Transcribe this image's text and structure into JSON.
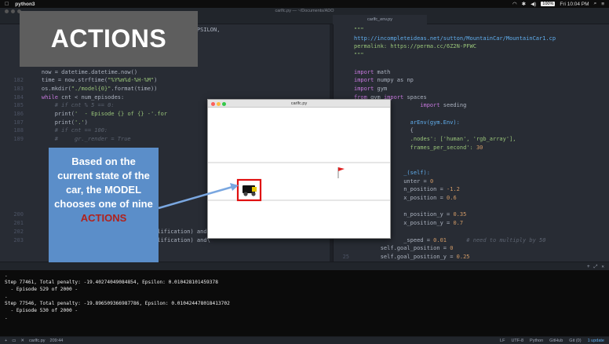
{
  "menubar": {
    "apple": "",
    "app_name": "python3",
    "battery": "100%",
    "clock": "Fri 10:04 PM"
  },
  "editor": {
    "window_title": "carlfc.py — ~/Documents/ADO",
    "left_tab": "",
    "right_tab": "carlfc_env.py",
    "left_lines": [
      {
        "n": "",
        "segs": [
          {
            "t": "                                     EPSILON, MIN_EPSILON,",
            "c": ""
          }
        ]
      },
      {
        "n": "",
        "segs": [
          {
            "t": "",
            "c": ""
          }
        ]
      },
      {
        "n": "",
        "segs": [
          {
            "t": "",
            "c": ""
          }
        ]
      },
      {
        "n": "",
        "segs": [
          {
            "t": "",
            "c": ""
          }
        ]
      },
      {
        "n": "",
        "segs": [
          {
            "t": "",
            "c": ""
          }
        ]
      },
      {
        "n": "",
        "segs": [
          {
            "t": "    now = datetime.datetime.now()",
            "c": ""
          }
        ]
      },
      {
        "n": "182",
        "segs": [
          {
            "t": "    time = now.strftime(",
            "c": ""
          },
          {
            "t": "\"%Y%m%d-%H-%M\"",
            "c": "str"
          },
          {
            "t": ")",
            "c": ""
          }
        ]
      },
      {
        "n": "183",
        "segs": [
          {
            "t": "    os.mkdir(",
            "c": ""
          },
          {
            "t": "\"./model{0}\"",
            "c": "str"
          },
          {
            "t": ".format(time))",
            "c": ""
          }
        ]
      },
      {
        "n": "184",
        "segs": [
          {
            "t": "    ",
            "c": ""
          },
          {
            "t": "while",
            "c": "kw"
          },
          {
            "t": " cnt < num_episodes:",
            "c": ""
          }
        ]
      },
      {
        "n": "185",
        "segs": [
          {
            "t": "        # if cnt % 5 == 0:",
            "c": "cm"
          }
        ]
      },
      {
        "n": "186",
        "segs": [
          {
            "t": "        print(",
            "c": ""
          },
          {
            "t": "'  - Episode {} of {} -'.for",
            "c": "str"
          }
        ]
      },
      {
        "n": "187",
        "segs": [
          {
            "t": "        print(",
            "c": ""
          },
          {
            "t": "'.'",
            "c": "str"
          },
          {
            "t": ")",
            "c": ""
          }
        ]
      },
      {
        "n": "188",
        "segs": [
          {
            "t": "        # if cnt == 100:",
            "c": "cm"
          }
        ]
      },
      {
        "n": "189",
        "segs": [
          {
            "t": "        #     gr._render = True",
            "c": "cm"
          }
        ]
      },
      {
        "n": "",
        "segs": [
          {
            "t": "",
            "c": ""
          }
        ]
      },
      {
        "n": "",
        "segs": [
          {
            "t": "",
            "c": ""
          }
        ]
      },
      {
        "n": "",
        "segs": [
          {
            "t": "                      ore[cnt])",
            "c": "cm"
          }
        ]
      },
      {
        "n": "",
        "segs": [
          {
            "t": "",
            "c": ""
          }
        ]
      },
      {
        "n": "",
        "segs": [
          {
            "t": "                      tore[cnt] > qu",
            "c": ""
          }
        ]
      },
      {
        "n": "",
        "segs": [
          {
            "t": "                      tore[cnt-1] > ",
            "c": ""
          }
        ]
      },
      {
        "n": "",
        "segs": [
          {
            "t": "                      tore[cnt-2] > ",
            "c": ""
          }
        ]
      },
      {
        "n": "",
        "segs": [
          {
            "t": "                      tore[cnt-3] > ",
            "c": ""
          }
        ]
      },
      {
        "n": "200",
        "segs": [
          {
            "t": "                      tore[cnt-4] > ",
            "c": ""
          }
        ]
      },
      {
        "n": "201",
        "segs": [
          {
            "t": "                      tore[cnt-5] > ",
            "c": ""
          }
        ]
      },
      {
        "n": "202",
        "segs": [
          {
            "t": "                      tore[cnt-6] > qualification) and\\",
            "c": ""
          }
        ]
      },
      {
        "n": "203",
        "segs": [
          {
            "t": "                      tore[cnt-7] > qualification) and\\",
            "c": ""
          }
        ]
      }
    ],
    "right_lines": [
      {
        "n": "",
        "segs": [
          {
            "t": "\"\"\"",
            "c": "str"
          }
        ]
      },
      {
        "n": "",
        "segs": [
          {
            "t": "http://incompleteideas.net/sutton/MountainCar/MountainCar1.cp",
            "c": "url"
          }
        ]
      },
      {
        "n": "",
        "segs": [
          {
            "t": "permalink: https://perma.cc/6Z2N-PFWC",
            "c": "str"
          }
        ]
      },
      {
        "n": "",
        "segs": [
          {
            "t": "\"\"\"",
            "c": "str"
          }
        ]
      },
      {
        "n": "",
        "segs": [
          {
            "t": "",
            "c": ""
          }
        ]
      },
      {
        "n": "",
        "segs": [
          {
            "t": "import",
            "c": "kw"
          },
          {
            "t": " math",
            "c": ""
          }
        ]
      },
      {
        "n": "",
        "segs": [
          {
            "t": "import",
            "c": "kw"
          },
          {
            "t": " numpy as np",
            "c": ""
          }
        ]
      },
      {
        "n": "",
        "segs": [
          {
            "t": "import",
            "c": "kw"
          },
          {
            "t": " gym",
            "c": ""
          }
        ]
      },
      {
        "n": "",
        "segs": [
          {
            "t": "from",
            "c": "kw"
          },
          {
            "t": " gym ",
            "c": ""
          },
          {
            "t": "import",
            "c": "kw"
          },
          {
            "t": " spaces",
            "c": ""
          }
        ]
      },
      {
        "n": "",
        "segs": [
          {
            "t": "                    import",
            "c": "kw"
          },
          {
            "t": " seeding",
            "c": ""
          }
        ]
      },
      {
        "n": "",
        "segs": [
          {
            "t": "",
            "c": ""
          }
        ]
      },
      {
        "n": "",
        "segs": [
          {
            "t": "                 arEnv(gym.Env):",
            "c": "fn"
          }
        ]
      },
      {
        "n": "",
        "segs": [
          {
            "t": "                 {",
            "c": ""
          }
        ]
      },
      {
        "n": "",
        "segs": [
          {
            "t": "                 .nodes': ['human', 'rgb_array'],",
            "c": "str"
          }
        ]
      },
      {
        "n": "",
        "segs": [
          {
            "t": "                 frames_per_second': ",
            "c": "str"
          },
          {
            "t": "30",
            "c": "num"
          }
        ]
      },
      {
        "n": "",
        "segs": [
          {
            "t": "",
            "c": ""
          }
        ]
      },
      {
        "n": "",
        "segs": [
          {
            "t": "",
            "c": ""
          }
        ]
      },
      {
        "n": "",
        "segs": [
          {
            "t": "               _(self):",
            "c": "fn"
          }
        ]
      },
      {
        "n": "",
        "segs": [
          {
            "t": "               unter = ",
            "c": ""
          },
          {
            "t": "0",
            "c": "num"
          }
        ]
      },
      {
        "n": "",
        "segs": [
          {
            "t": "               n_position = ",
            "c": ""
          },
          {
            "t": "-1.2",
            "c": "num"
          }
        ]
      },
      {
        "n": "",
        "segs": [
          {
            "t": "               x_position = ",
            "c": ""
          },
          {
            "t": "0.6",
            "c": "num"
          }
        ]
      },
      {
        "n": "",
        "segs": [
          {
            "t": "",
            "c": ""
          }
        ]
      },
      {
        "n": "",
        "segs": [
          {
            "t": "               n_position_y = ",
            "c": ""
          },
          {
            "t": "0.35",
            "c": "num"
          }
        ]
      },
      {
        "n": "",
        "segs": [
          {
            "t": "               x_position_y = ",
            "c": ""
          },
          {
            "t": "0.7",
            "c": "num"
          }
        ]
      },
      {
        "n": "",
        "segs": [
          {
            "t": "",
            "c": ""
          }
        ]
      },
      {
        "n": "",
        "segs": [
          {
            "t": "               _speed = ",
            "c": ""
          },
          {
            "t": "0.01",
            "c": "num"
          },
          {
            "t": "      # need to multiply by 50",
            "c": "cm"
          }
        ]
      },
      {
        "n": "",
        "segs": [
          {
            "t": "        self.goal_position = ",
            "c": ""
          },
          {
            "t": "0",
            "c": "num"
          }
        ]
      },
      {
        "n": "25",
        "segs": [
          {
            "t": "        self.goal_position_y = ",
            "c": ""
          },
          {
            "t": "0.25",
            "c": "num"
          }
        ]
      }
    ]
  },
  "banner": {
    "title": "ACTIONS"
  },
  "game_window": {
    "title": "carlfc.py"
  },
  "callout": {
    "text": "Based on the current state of the car, the MODEL chooses one of nine",
    "highlight": "ACTIONS",
    "highlight_color": "#b0221c",
    "box_color": "#5b8ec9"
  },
  "terminal": {
    "lines": [
      ".",
      "Step 77461, Total penalty: -19.40274049084854, Epsilon: 0.010428101459378",
      "  - Episode 529 of 2000 -",
      ".",
      "Step 77546, Total penalty: -19.896509366987786, Epsilon: 0.010424478018413702",
      "  - Episode 530 of 2000 -",
      "."
    ]
  },
  "statusbar": {
    "file": "carlfc.py",
    "position": "209:44",
    "line_ending": "LF",
    "encoding": "UTF-8",
    "grammar": "Python",
    "github": "GitHub",
    "git": "Git (0)",
    "update": "1 update"
  }
}
